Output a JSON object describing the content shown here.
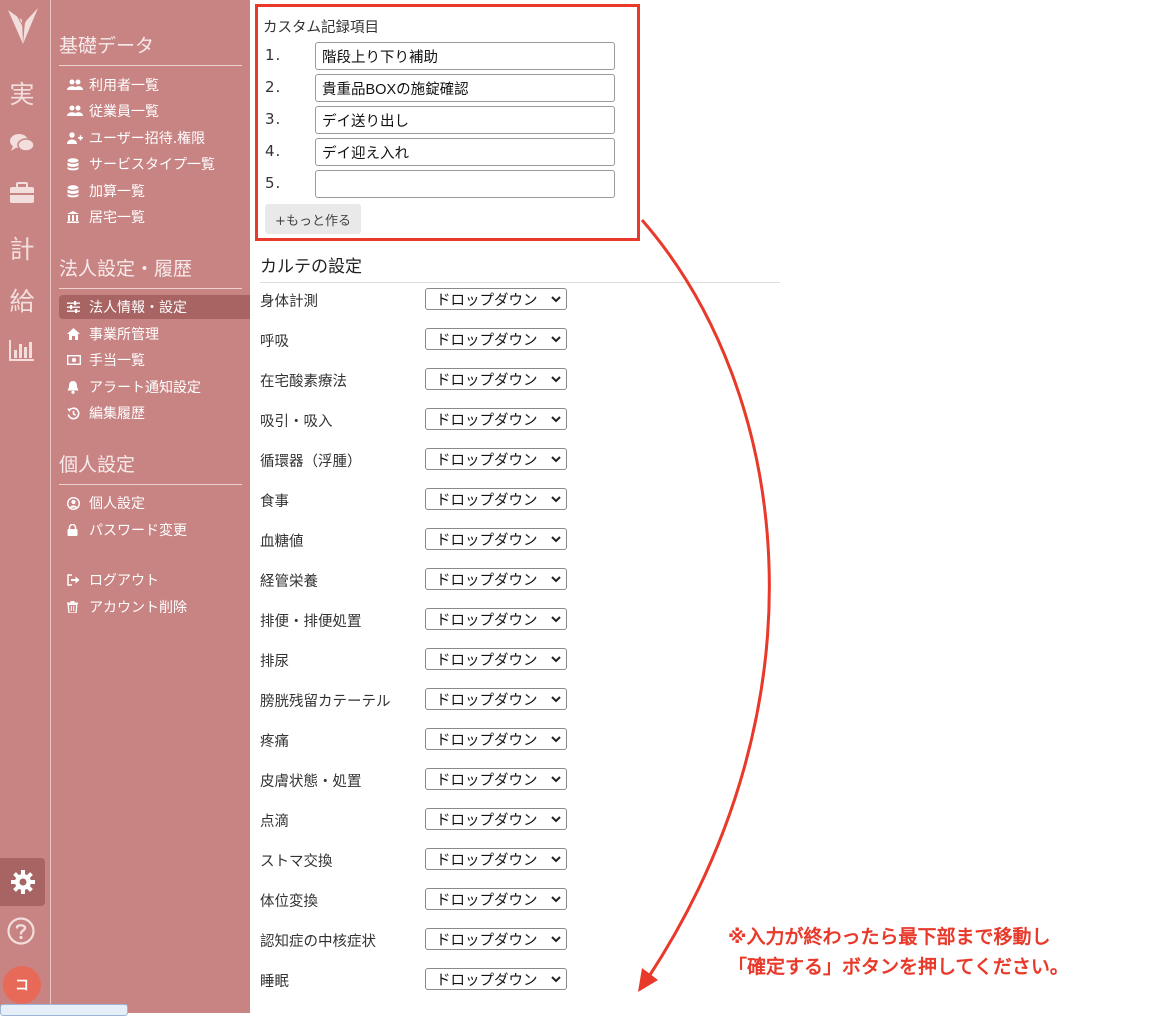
{
  "rail": {
    "items": [
      {
        "glyph": "実"
      },
      {
        "glyph": ""
      },
      {
        "glyph": ""
      },
      {
        "glyph": "計"
      },
      {
        "glyph": "給"
      },
      {
        "glyph": ""
      }
    ],
    "avatar_text": "コ",
    "icons": [
      "logo-icon",
      "chat-icon",
      "briefcase-icon",
      "chart-icon",
      "gear-icon",
      "help-icon"
    ]
  },
  "sidebar": {
    "sections": [
      {
        "heading": "基礎データ",
        "items": [
          "利用者一覧",
          "従業員一覧",
          "ユーザー招待.権限",
          "サービスタイプ一覧",
          "加算一覧",
          "居宅一覧"
        ]
      },
      {
        "heading": "法人設定・履歴",
        "items": [
          "法人情報・設定",
          "事業所管理",
          "手当一覧",
          "アラート通知設定",
          "編集履歴"
        ]
      },
      {
        "heading": "個人設定",
        "items": [
          "個人設定",
          "パスワード変更"
        ]
      },
      {
        "heading": "",
        "items": [
          "ログアウト",
          "アカウント削除"
        ]
      }
    ],
    "active_item": "法人情報・設定"
  },
  "custom": {
    "title": "カスタム記録項目",
    "rows": [
      {
        "num": "1.",
        "value": "階段上り下り補助"
      },
      {
        "num": "2.",
        "value": "貴重品BOXの施錠確認"
      },
      {
        "num": "3.",
        "value": "デイ送り出し"
      },
      {
        "num": "4.",
        "value": "デイ迎え入れ"
      },
      {
        "num": "5.",
        "value": ""
      }
    ],
    "more_label": "+もっと作る"
  },
  "karte": {
    "title": "カルテの設定",
    "rows": [
      {
        "label": "身体計測",
        "select": "ドロップダウン"
      },
      {
        "label": "呼吸",
        "select": "ドロップダウン"
      },
      {
        "label": "在宅酸素療法",
        "select": "ドロップダウン"
      },
      {
        "label": "吸引・吸入",
        "select": "ドロップダウン"
      },
      {
        "label": "循環器（浮腫）",
        "select": "ドロップダウン"
      },
      {
        "label": "食事",
        "select": "ドロップダウン"
      },
      {
        "label": "血糖値",
        "select": "ドロップダウン"
      },
      {
        "label": "経管栄養",
        "select": "ドロップダウン"
      },
      {
        "label": "排便・排便処置",
        "select": "ドロップダウン"
      },
      {
        "label": "排尿",
        "select": "ドロップダウン"
      },
      {
        "label": "膀胱残留カテーテル",
        "select": "ドロップダウン"
      },
      {
        "label": "疼痛",
        "select": "ドロップダウン"
      },
      {
        "label": "皮膚状態・処置",
        "select": "ドロップダウン"
      },
      {
        "label": "点滴",
        "select": "ドロップダウン"
      },
      {
        "label": "ストマ交換",
        "select": "ドロップダウン"
      },
      {
        "label": "体位変換",
        "select": "ドロップダウン"
      },
      {
        "label": "認知症の中核症状",
        "select": "ドロップダウン"
      },
      {
        "label": "睡眠",
        "select": "ドロップダウン"
      }
    ]
  },
  "annotation": {
    "line1": "※入力が終わったら最下部まで移動し",
    "line2": "「確定する」ボタンを押してください。",
    "color": "#e8392a"
  }
}
